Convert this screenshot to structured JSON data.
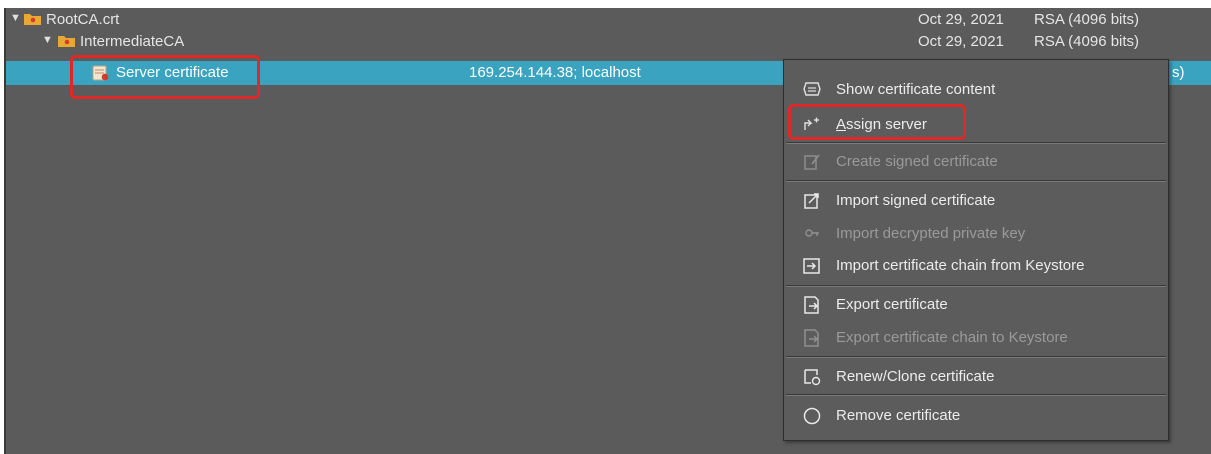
{
  "tree": {
    "rows": [
      {
        "name": "RootCA.crt",
        "date": "Oct 29, 2021",
        "algorithm": "RSA (4096 bits)"
      },
      {
        "name": "IntermediateCA",
        "date": "Oct 29, 2021",
        "algorithm": "RSA (4096 bits)"
      },
      {
        "name": "Server certificate",
        "hosts": "169.254.144.38; localhost",
        "algorithm_tail": "s)"
      }
    ]
  },
  "context_menu": {
    "items": [
      {
        "label": "Show certificate content",
        "icon": "certificate-icon",
        "enabled": true
      },
      {
        "label_accel": "A",
        "label_rest": "ssign server",
        "icon": "assign-server-icon",
        "enabled": true
      },
      {
        "label": "Create signed certificate",
        "icon": "sign-icon",
        "enabled": false
      },
      {
        "label": "Import signed certificate",
        "icon": "import-signed-icon",
        "enabled": true
      },
      {
        "label": "Import decrypted private key",
        "icon": "key-icon",
        "enabled": false
      },
      {
        "label": "Import certificate chain from Keystore",
        "icon": "import-chain-icon",
        "enabled": true
      },
      {
        "label": "Export certificate",
        "icon": "export-icon",
        "enabled": true
      },
      {
        "label": "Export certificate chain to Keystore",
        "icon": "export-chain-icon",
        "enabled": false
      },
      {
        "label": "Renew/Clone certificate",
        "icon": "renew-icon",
        "enabled": true
      },
      {
        "label": "Remove certificate",
        "icon": "remove-icon",
        "enabled": true
      }
    ]
  },
  "colors": {
    "panel_bg": "#5b5b5b",
    "selection": "#3aa3c0",
    "highlight_box": "#e02828",
    "folder": "#e8a832"
  }
}
